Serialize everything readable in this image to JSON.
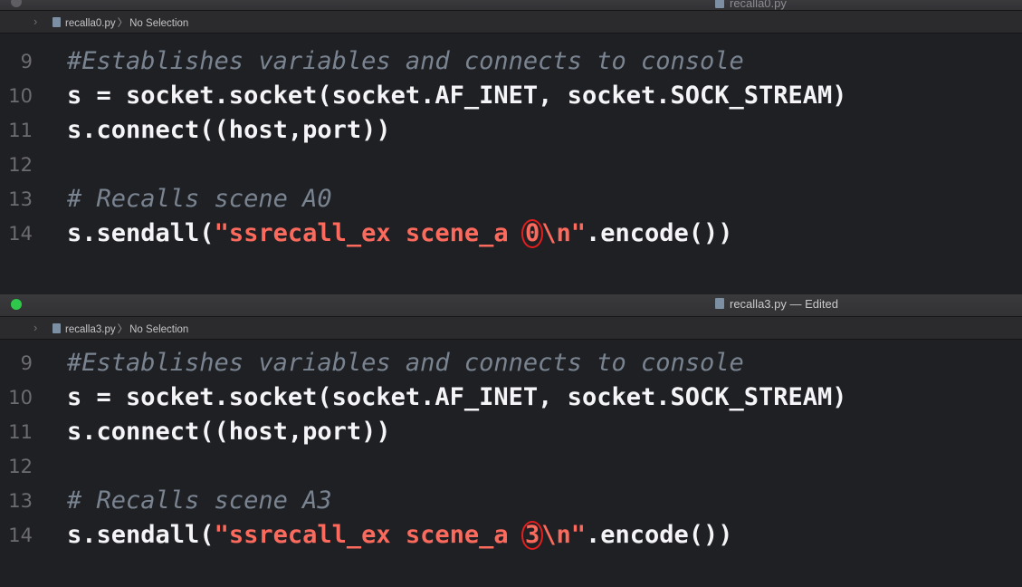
{
  "windows": [
    {
      "title": "recalla0.py",
      "jumpbar": {
        "file": "recalla0.py",
        "selection": "No Selection"
      },
      "lines": [
        {
          "number": "9",
          "parts": [
            {
              "t": "#Establishes variables and connects to console",
              "c": "comment"
            }
          ]
        },
        {
          "number": "10",
          "parts": [
            {
              "t": "s = socket.socket(socket.AF_INET, socket.SOCK_STREAM)",
              "c": "plain"
            }
          ]
        },
        {
          "number": "11",
          "parts": [
            {
              "t": "s.connect((host,port))",
              "c": "plain"
            }
          ]
        },
        {
          "number": "12",
          "parts": []
        },
        {
          "number": "13",
          "parts": [
            {
              "t": "# Recalls scene A0",
              "c": "comment"
            }
          ]
        },
        {
          "number": "14",
          "parts": [
            {
              "t": "s.sendall(",
              "c": "plain"
            },
            {
              "t": "\"ssrecall_ex scene_a ",
              "c": "str"
            },
            {
              "t": "0",
              "c": "str-circled"
            },
            {
              "t": "\\n\"",
              "c": "str"
            },
            {
              "t": ".encode())",
              "c": "plain"
            }
          ]
        }
      ]
    },
    {
      "title": "recalla3.py — Edited",
      "jumpbar": {
        "file": "recalla3.py",
        "selection": "No Selection"
      },
      "lines": [
        {
          "number": "9",
          "parts": [
            {
              "t": "#Establishes variables and connects to console",
              "c": "comment"
            }
          ]
        },
        {
          "number": "10",
          "parts": [
            {
              "t": "s = socket.socket(socket.AF_INET, socket.SOCK_STREAM)",
              "c": "plain"
            }
          ]
        },
        {
          "number": "11",
          "parts": [
            {
              "t": "s.connect((host,port))",
              "c": "plain"
            }
          ]
        },
        {
          "number": "12",
          "parts": []
        },
        {
          "number": "13",
          "parts": [
            {
              "t": "# Recalls scene A3",
              "c": "comment"
            }
          ]
        },
        {
          "number": "14",
          "parts": [
            {
              "t": "s.sendall(",
              "c": "plain"
            },
            {
              "t": "\"ssrecall_ex scene_a ",
              "c": "str"
            },
            {
              "t": "3",
              "c": "str-circled"
            },
            {
              "t": "\\n\"",
              "c": "str"
            },
            {
              "t": ".encode())",
              "c": "plain"
            }
          ]
        }
      ]
    }
  ],
  "colors": {
    "background": "#1f2024",
    "plain": "#f5f5f7",
    "comment": "#7a8491",
    "string": "#fc6a5d",
    "annotation_circle": "#e41d1d",
    "traffic_light_active": "#2ec94a"
  }
}
